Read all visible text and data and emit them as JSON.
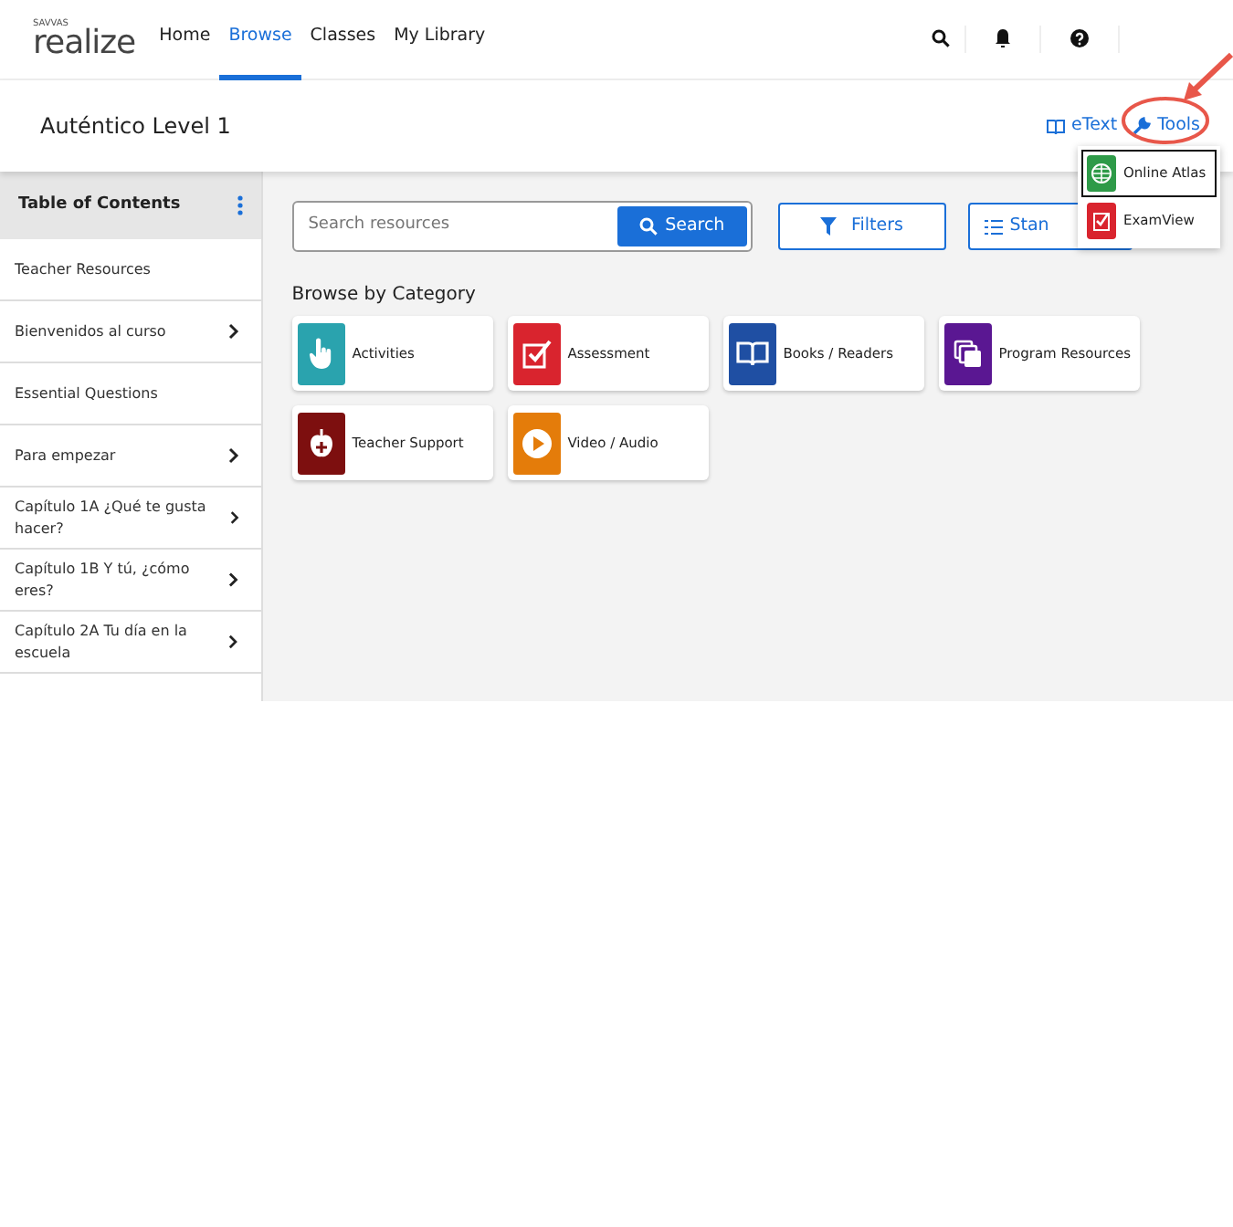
{
  "logo": {
    "brand": "SAVVAS",
    "name": "realize"
  },
  "nav": [
    {
      "label": "Home",
      "selected": false
    },
    {
      "label": "Browse",
      "selected": true
    },
    {
      "label": "Classes",
      "selected": false
    },
    {
      "label": "My Library",
      "selected": false
    }
  ],
  "header": {
    "title": "Auténtico Level 1",
    "links": [
      "eText",
      "Tools"
    ]
  },
  "tools_menu": [
    {
      "label": "Online Atlas",
      "selected": true,
      "color": "#2e9a48"
    },
    {
      "label": "ExamView",
      "selected": false,
      "color": "#d9242e"
    }
  ],
  "sidebar": {
    "title": "Table of Contents",
    "items": [
      {
        "label": "Teacher Resources",
        "expandable": false
      },
      {
        "label": "Bienvenidos al curso",
        "expandable": true
      },
      {
        "label": "Essential Questions",
        "expandable": false
      },
      {
        "label": "Para empezar",
        "expandable": true
      },
      {
        "label": "Capítulo 1A ¿Qué te gusta hacer?",
        "expandable": true
      },
      {
        "label": "Capítulo 1B Y tú, ¿cómo eres?",
        "expandable": true
      },
      {
        "label": "Capítulo 2A Tu día en la escuela",
        "expandable": true
      }
    ]
  },
  "search": {
    "placeholder": "Search resources",
    "button": "Search"
  },
  "filters": {
    "label": "Filters"
  },
  "standards": {
    "label": "Stan"
  },
  "browse": {
    "heading": "Browse by Category",
    "categories": [
      {
        "label": "Activities",
        "kind": "hand",
        "color": "#2aa3ae"
      },
      {
        "label": "Assessment",
        "kind": "check",
        "color": "#d9242e"
      },
      {
        "label": "Books / Readers",
        "kind": "book",
        "color": "#1f4fa3"
      },
      {
        "label": "Program Resources",
        "kind": "stack",
        "color": "#5a1792"
      },
      {
        "label": "Teacher Support",
        "kind": "apple",
        "color": "#7d0f0f"
      },
      {
        "label": "Video / Audio",
        "kind": "play",
        "color": "#e47c0a"
      }
    ]
  }
}
